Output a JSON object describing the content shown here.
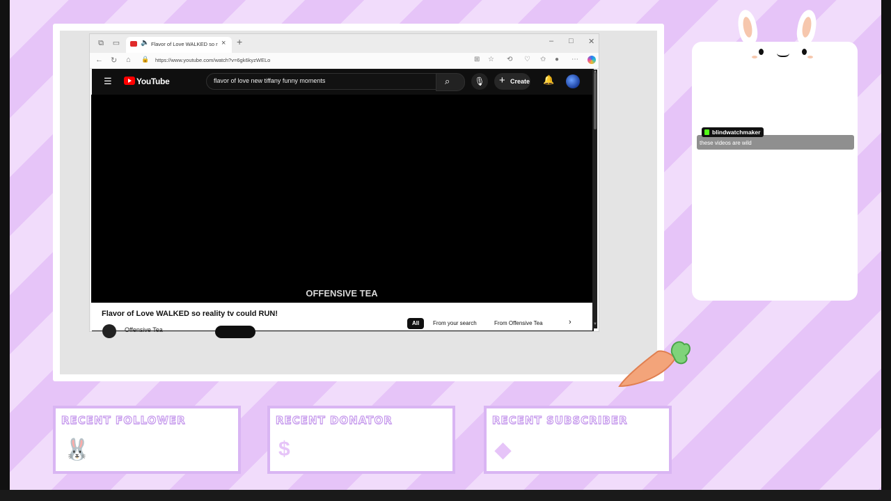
{
  "browser": {
    "tab_title": "Flavor of Love WALKED so re",
    "url": "https://www.youtube.com/watch?v=6gk6kyzWELo"
  },
  "youtube": {
    "logo_text": "YouTube",
    "search_query": "flavor of love new tiffany funny moments",
    "create_label": "Create",
    "watermark": "OFFENSIVE TEA",
    "video_title": "Flavor of Love WALKED so reality tv could RUN!",
    "channel_name": "Offensive Tea",
    "chips": [
      "All",
      "From your search",
      "From Offensive Tea"
    ]
  },
  "chat": {
    "username": "blindwatchmaker",
    "message": "these videos are wild"
  },
  "widgets": {
    "follower_title": "RECENT FOLLOWER",
    "donator_title": "RECENT DONATOR",
    "subscriber_title": "RECENT SUBSCRIBER",
    "donator_symbol": "$"
  },
  "colors": {
    "stripe_light": "#f1dcfb",
    "stripe_dark": "#e6c4f8",
    "widget_border": "#d9b5f3",
    "youtube_red": "#ff0000",
    "kick_green": "#53fc18"
  },
  "icons": [
    "workspaces-icon",
    "tab-actions-icon",
    "youtube-favicon",
    "speaker-icon",
    "close-icon",
    "new-tab-icon",
    "minimize-icon",
    "maximize-icon",
    "back-icon",
    "refresh-icon",
    "home-icon",
    "lock-icon",
    "split-screen-icon",
    "favorite-star-icon",
    "extensions-icon",
    "browser-essentials-icon",
    "favorites-icon",
    "profile-icon",
    "more-icon",
    "copilot-icon",
    "menu-icon",
    "search-icon",
    "mic-icon",
    "plus-icon",
    "bell-icon",
    "bunny-icon",
    "diamond-icon",
    "kick-icon",
    "carrot-icon"
  ]
}
